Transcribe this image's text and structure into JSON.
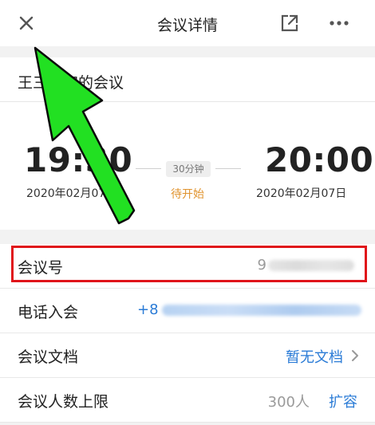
{
  "header": {
    "title": "会议详情",
    "close_icon": "close-icon",
    "share_icon": "external-share-icon",
    "more_icon": "more-horizontal-icon"
  },
  "meeting": {
    "subject": "王三预定的会议",
    "start_time": "19:30",
    "start_date": "2020年02月07日",
    "end_time": "20:00",
    "end_date": "2020年02月07日",
    "duration": "30分钟",
    "status": "待开始"
  },
  "rows": {
    "meeting_id": {
      "label": "会议号",
      "value": "9"
    },
    "dial_in": {
      "label": "电话入会",
      "value": "+8"
    },
    "documents": {
      "label": "会议文档",
      "value": "暂无文档"
    },
    "capacity": {
      "label": "会议人数上限",
      "value": "300人",
      "action": "扩容"
    }
  },
  "colors": {
    "accent_blue": "#2a7bd6",
    "status_orange": "#e0932e",
    "highlight_red": "#e0141a",
    "annotation_green": "#22e022"
  }
}
